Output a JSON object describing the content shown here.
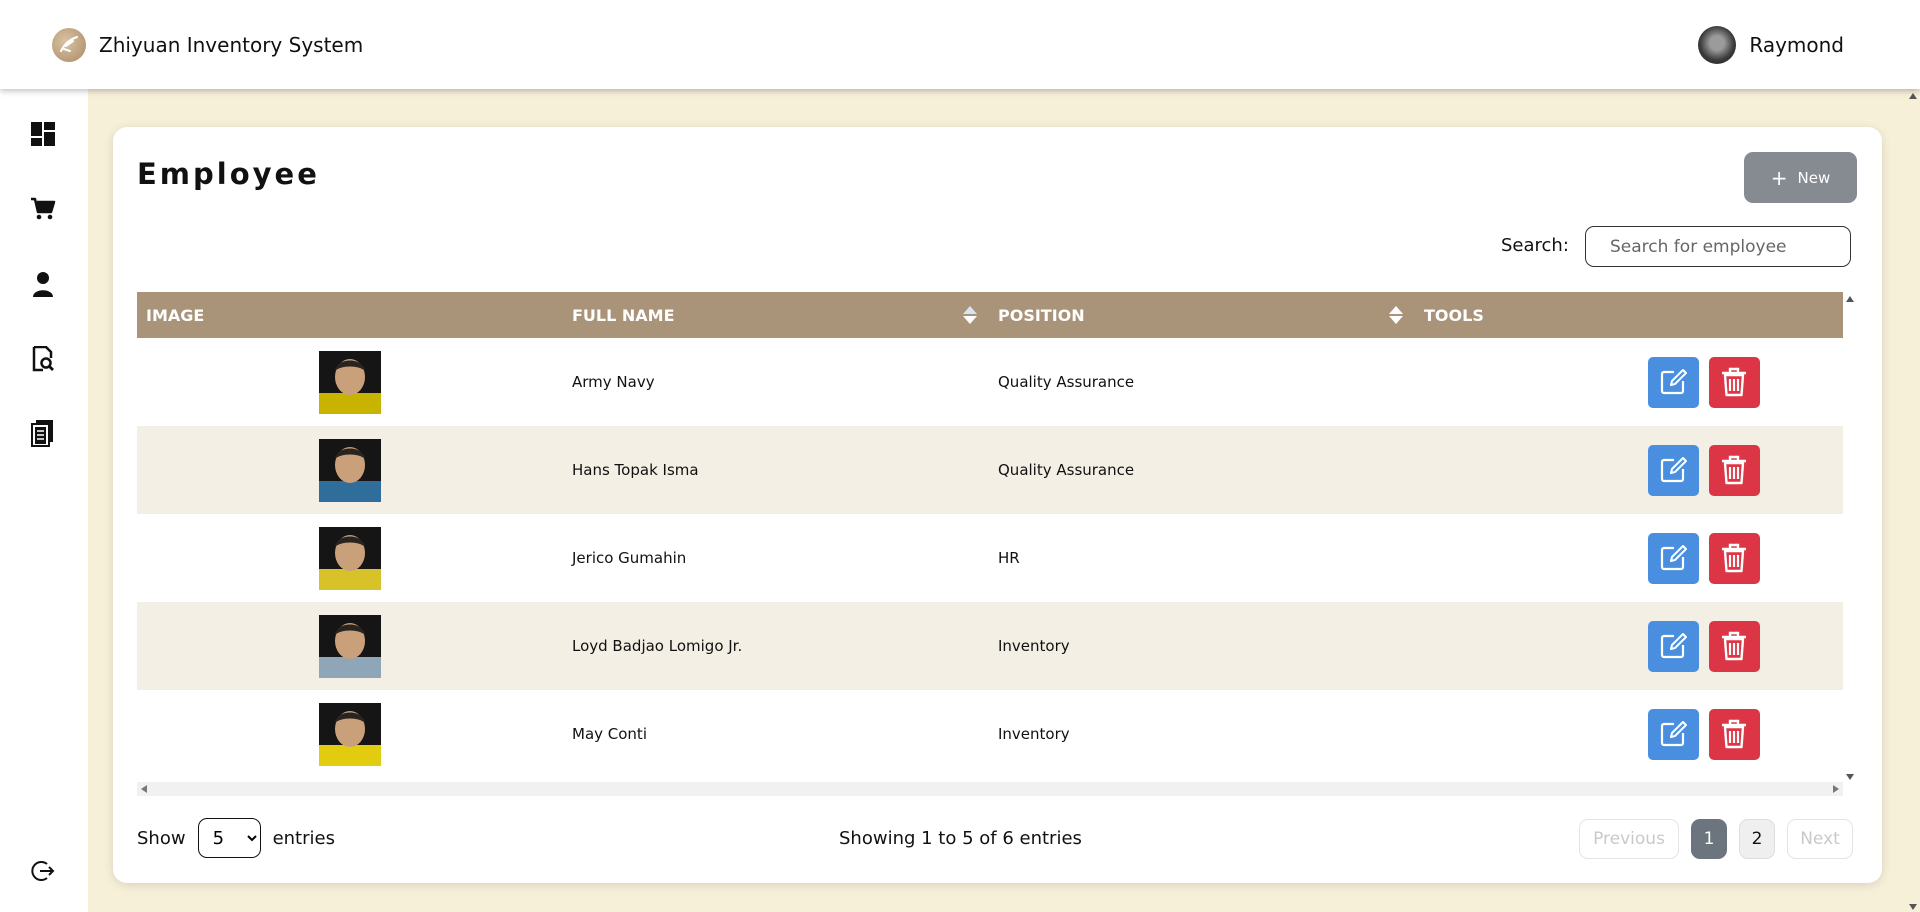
{
  "header": {
    "app_title": "Zhiyuan Inventory System",
    "user_name": "Raymond"
  },
  "sidebar": {
    "items": [
      {
        "icon": "dashboard-icon"
      },
      {
        "icon": "cart-icon"
      },
      {
        "icon": "user-icon"
      },
      {
        "icon": "report-search-icon"
      },
      {
        "icon": "documents-icon"
      }
    ],
    "logout_icon": "logout-icon"
  },
  "page": {
    "title": "Employee",
    "new_button": "New",
    "search_label": "Search:",
    "search_placeholder": "Search for employee"
  },
  "table": {
    "columns": [
      "IMAGE",
      "FULL NAME",
      "POSITION",
      "TOOLS"
    ],
    "rows": [
      {
        "full_name": "Army Navy",
        "position": "Quality Assurance",
        "photo_bg": "#c8b400"
      },
      {
        "full_name": "Hans Topak Isma",
        "position": "Quality Assurance",
        "photo_bg": "#2f6d9a"
      },
      {
        "full_name": "Jerico Gumahin",
        "position": "HR",
        "photo_bg": "#d8c22a"
      },
      {
        "full_name": "Loyd Badjao Lomigo Jr.",
        "position": "Inventory",
        "photo_bg": "#8fa6b8"
      },
      {
        "full_name": "May Conti",
        "position": "Inventory",
        "photo_bg": "#e2cc10"
      }
    ]
  },
  "footer": {
    "show_label": "Show",
    "entries_value": "5",
    "entries_label": "entries",
    "showing_text": "Showing 1 to 5 of 6 entries",
    "previous": "Previous",
    "page_1": "1",
    "page_2": "2",
    "next": "Next"
  },
  "colors": {
    "header_bg": "#a99379",
    "edit": "#4a8fdf",
    "delete": "#dc3545",
    "new_button": "#868b91",
    "background": "#f6f0d9"
  }
}
